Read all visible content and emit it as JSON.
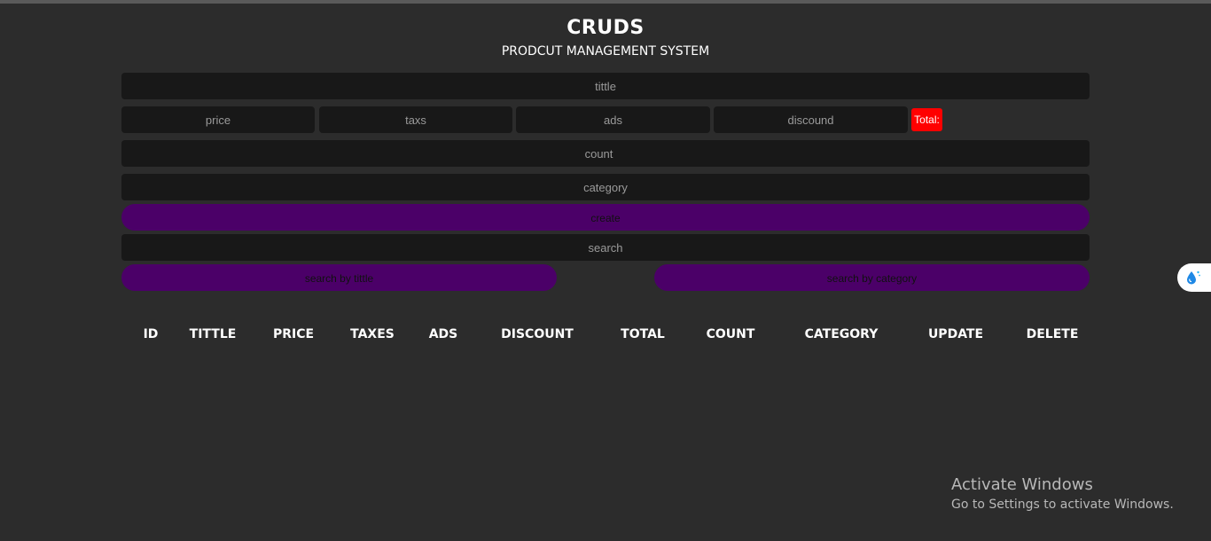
{
  "header": {
    "title": "CRUDS",
    "subtitle": "PRODCUT MANAGEMENT SYSTEM"
  },
  "form": {
    "title_placeholder": "tittle",
    "price_placeholder": "price",
    "taxes_placeholder": "taxs",
    "ads_placeholder": "ads",
    "discount_placeholder": "discound",
    "total_label": "Total:",
    "count_placeholder": "count",
    "category_placeholder": "category",
    "create_label": "create"
  },
  "search": {
    "placeholder": "search",
    "by_title_label": "search by tittle",
    "by_category_label": "search by category"
  },
  "table": {
    "headers": [
      "ID",
      "TITTLE",
      "PRICE",
      "TAXES",
      "ADS",
      "DISCOUNT",
      "TOTAL",
      "COUNT",
      "CATEGORY",
      "UPDATE",
      "DELETE"
    ]
  },
  "watermark": {
    "title": "Activate Windows",
    "subtitle": "Go to Settings to activate Windows."
  },
  "colors": {
    "background": "#2c2c2c",
    "input": "#181818",
    "button": "#4b0068",
    "total": "#ff0000"
  },
  "icons": {
    "side_widget": "water-drop-icon"
  }
}
